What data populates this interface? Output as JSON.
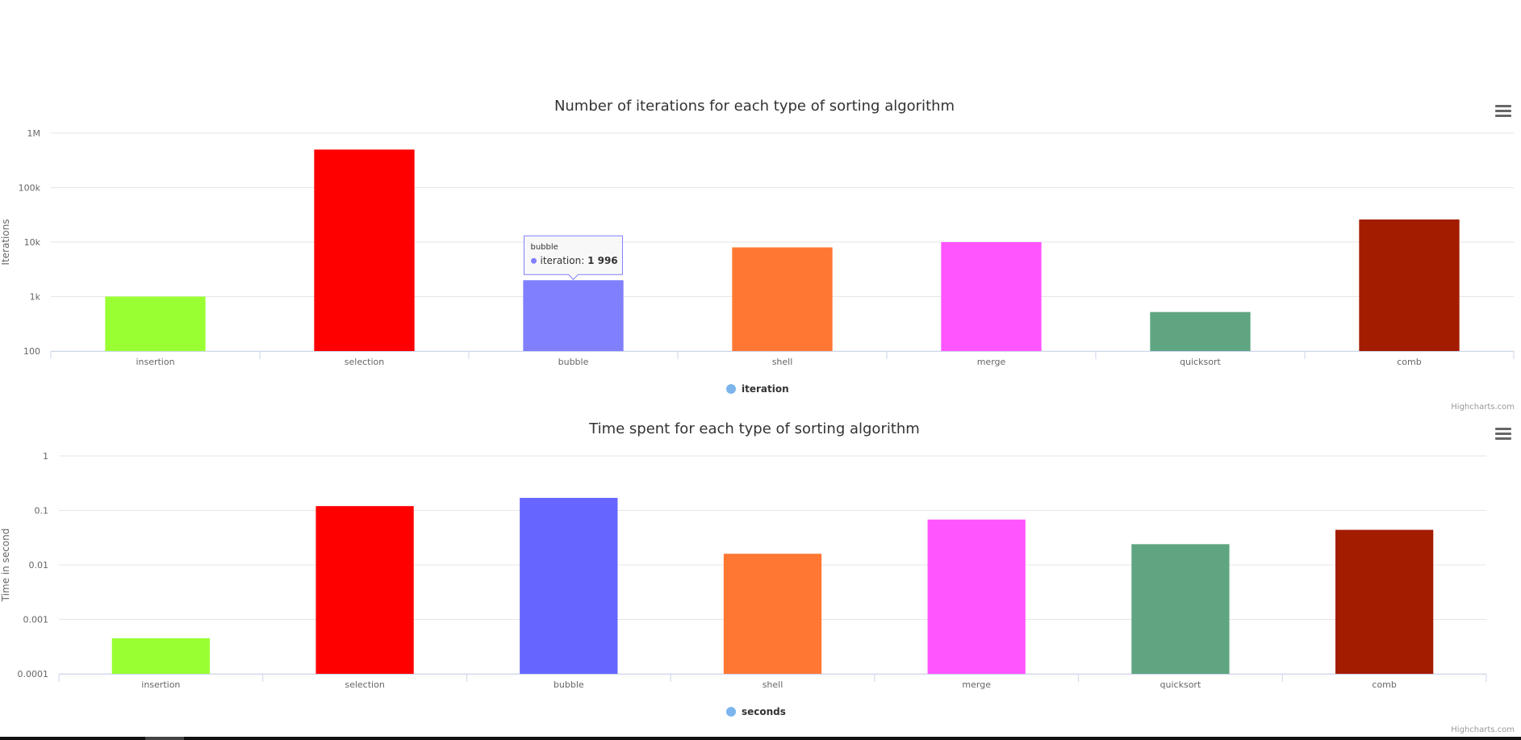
{
  "charts": [
    {
      "id": "iterations",
      "title": "Number of iterations for each type of sorting algorithm",
      "ylabel": "Iterations",
      "yticks": [
        "100",
        "1k",
        "10k",
        "100k",
        "1M"
      ],
      "legend": "iteration",
      "credit": "Highcharts.com",
      "tooltip": {
        "category": "bubble",
        "series": "iteration",
        "value": "1 996"
      }
    },
    {
      "id": "seconds",
      "title": "Time spent for each type of sorting algorithm",
      "ylabel": "Time in second",
      "yticks": [
        "0.0001",
        "0.001",
        "0.01",
        "0.1",
        "1"
      ],
      "legend": "seconds",
      "credit": "Highcharts.com"
    }
  ],
  "chart_data": [
    {
      "type": "bar",
      "title": "Number of iterations for each type of sorting algorithm",
      "xlabel": "",
      "ylabel": "Iterations",
      "yscale": "log",
      "ylim": [
        100,
        1000000
      ],
      "grid": true,
      "legend_position": "bottom-center",
      "categories": [
        "insertion",
        "selection",
        "bubble",
        "shell",
        "merge",
        "quicksort",
        "comb"
      ],
      "series": [
        {
          "name": "iteration",
          "values": [
            1000,
            499500,
            1996,
            8000,
            9980,
            520,
            26000
          ]
        }
      ],
      "colors": [
        "#99ff33",
        "#ff0000",
        "#8080ff",
        "#ff7733",
        "#ff55ff",
        "#5fa582",
        "#a31c00"
      ],
      "legend_color": "#7cb5ec"
    },
    {
      "type": "bar",
      "title": "Time spent for each type of sorting algorithm",
      "xlabel": "",
      "ylabel": "Time in second",
      "yscale": "log",
      "ylim": [
        0.0001,
        1
      ],
      "grid": true,
      "legend_position": "bottom-center",
      "categories": [
        "insertion",
        "selection",
        "bubble",
        "shell",
        "merge",
        "quicksort",
        "comb"
      ],
      "series": [
        {
          "name": "seconds",
          "values": [
            0.00045,
            0.12,
            0.17,
            0.016,
            0.068,
            0.024,
            0.044
          ]
        }
      ],
      "colors": [
        "#99ff33",
        "#ff0000",
        "#6666ff",
        "#ff7733",
        "#ff55ff",
        "#5fa582",
        "#a31c00"
      ],
      "legend_color": "#7cb5ec"
    }
  ]
}
